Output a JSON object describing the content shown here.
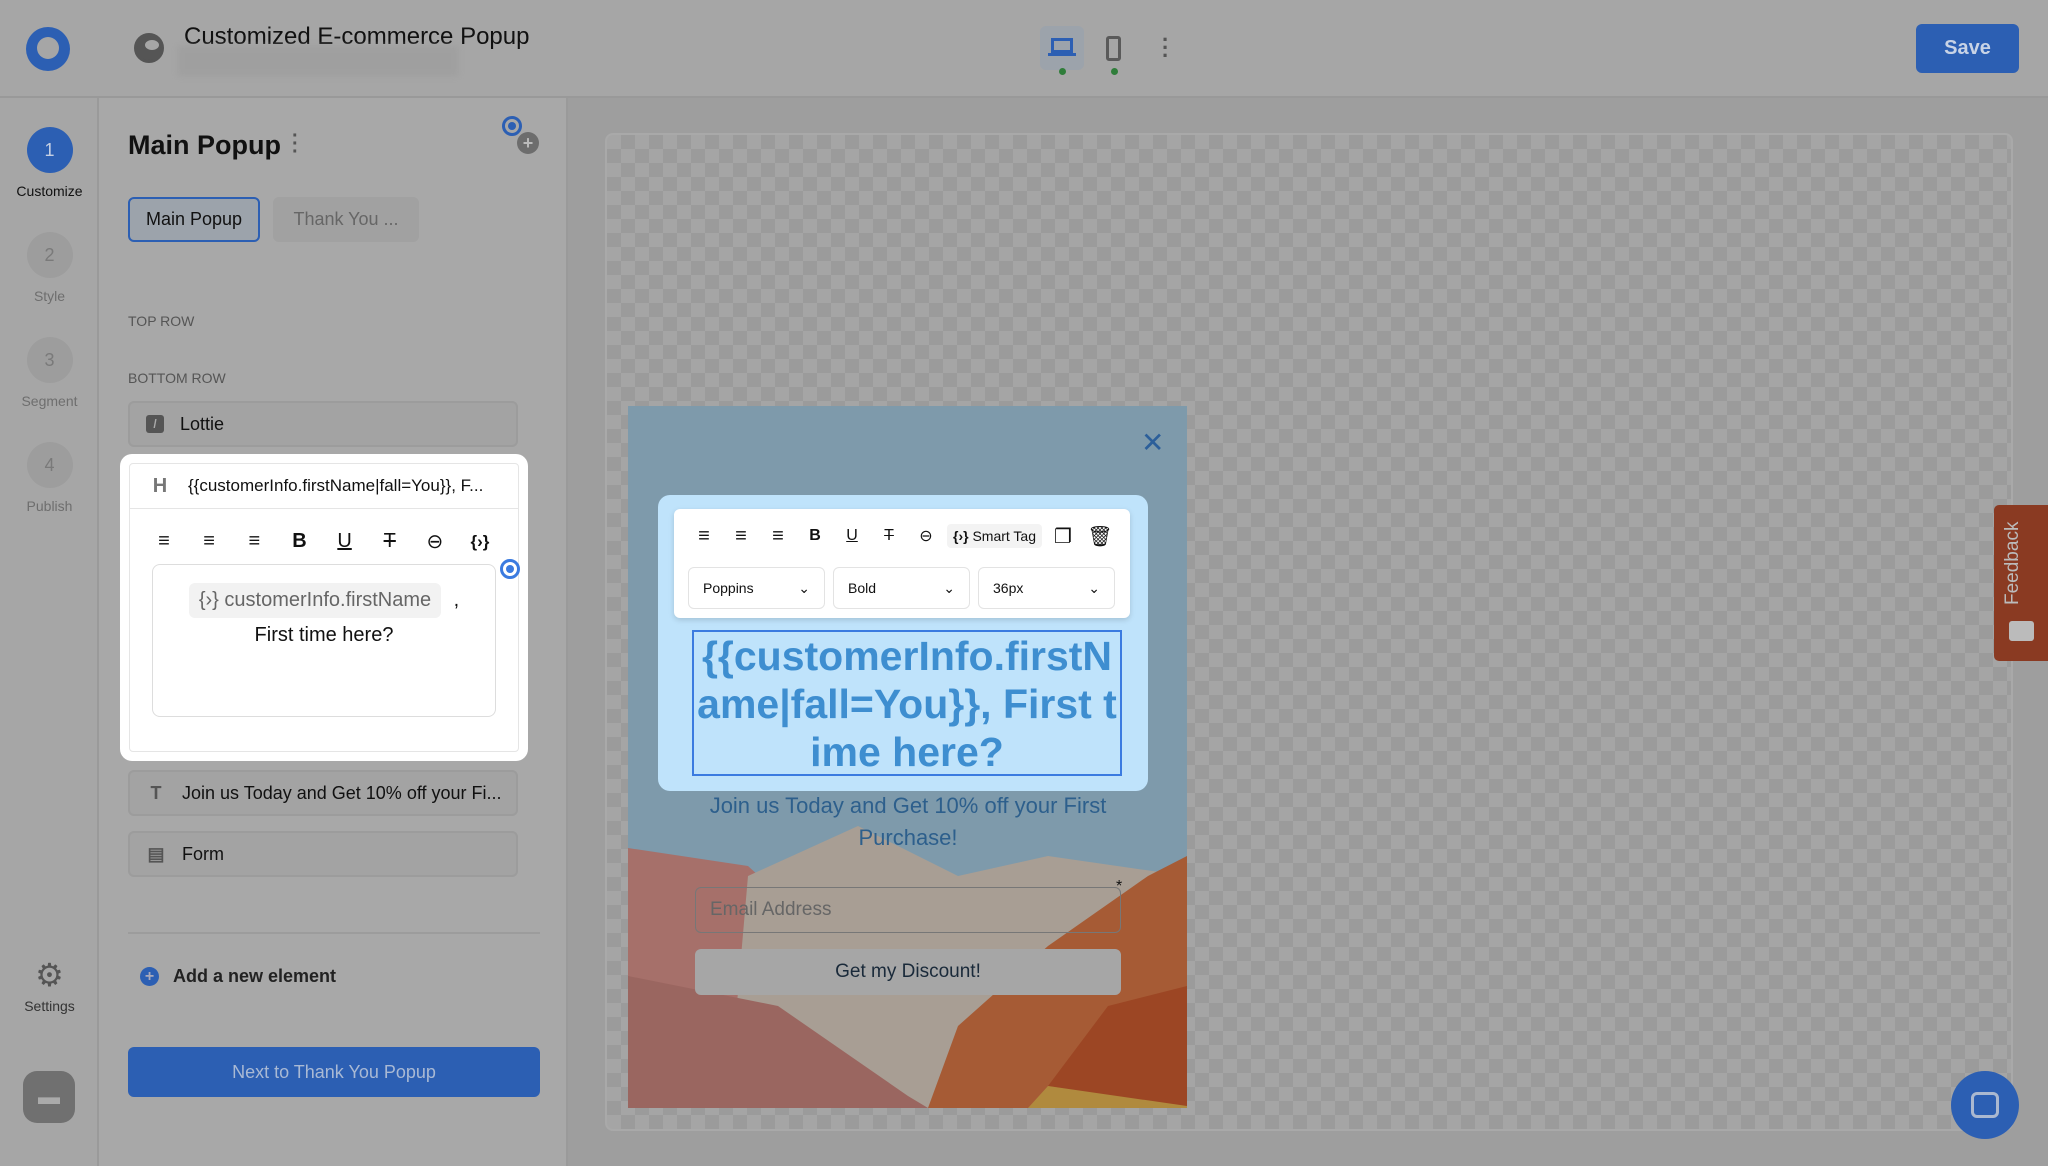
{
  "header": {
    "title": "Customized E-commerce Popup",
    "save_label": "Save"
  },
  "steps": [
    {
      "num": "1",
      "label": "Customize",
      "active": true
    },
    {
      "num": "2",
      "label": "Style"
    },
    {
      "num": "3",
      "label": "Segment"
    },
    {
      "num": "4",
      "label": "Publish"
    }
  ],
  "rail": {
    "settings_label": "Settings"
  },
  "panel": {
    "title": "Main Popup",
    "tabs": [
      "Main Popup",
      "Thank You ..."
    ],
    "top_row_label": "TOP ROW",
    "bottom_row_label": "BOTTOM ROW",
    "elements": [
      {
        "icon": "lottie-icon",
        "label": "Lottie"
      },
      {
        "icon": "heading-icon",
        "icon_text": "H",
        "label": "{{customerInfo.firstName|fall=You}}, F..."
      },
      {
        "icon": "text-icon",
        "icon_text": "T",
        "label": "Join us Today and Get 10% off your Fi..."
      },
      {
        "icon": "form-icon",
        "label": "Form"
      }
    ],
    "editor": {
      "smart_tag": "customerInfo.firstName",
      "comma": ",",
      "text": "First time here?"
    },
    "add_element_label": "Add a new element",
    "next_button": "Next to Thank You Popup"
  },
  "popup": {
    "heading": "{{customerInfo.firstName|fall=You}}, First time here?",
    "subtitle": "Join us Today and Get 10% off your First Purchase!",
    "email_placeholder": "Email Address",
    "required_mark": "*",
    "cta": "Get my Discount!",
    "toolbar": {
      "smart_tag_label": "Smart Tag",
      "font": "Poppins",
      "weight": "Bold",
      "size": "36px"
    }
  },
  "feedback": {
    "label": "Feedback"
  },
  "colors": {
    "accent": "#2c5fb3",
    "heading": "#3e8ed0",
    "feedback": "#8a3a22"
  }
}
